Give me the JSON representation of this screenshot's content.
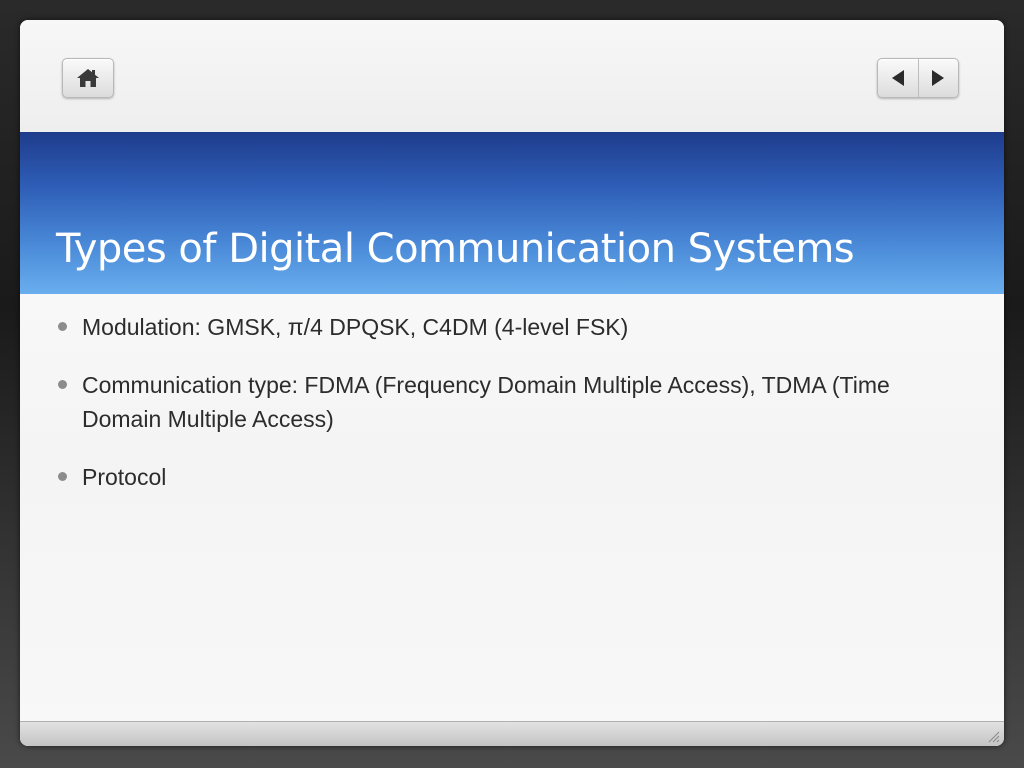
{
  "slide": {
    "title": "Types of Digital Communication Systems",
    "bullets": [
      "Modulation: GMSK, π/4 DPQSK, C4DM (4-level FSK)",
      "Communication type: FDMA (Frequency Domain Multiple Access), TDMA (Time Domain Multiple Access)",
      "Protocol"
    ]
  },
  "toolbar": {
    "home_icon": "home-icon",
    "prev_icon": "triangle-left-icon",
    "next_icon": "triangle-right-icon"
  },
  "colors": {
    "banner_top": "#1e3c8c",
    "banner_bottom": "#6aaeee",
    "title_text": "#ffffff",
    "body_text": "#2c2c2c",
    "bullet_dot": "#8c8c8c"
  }
}
